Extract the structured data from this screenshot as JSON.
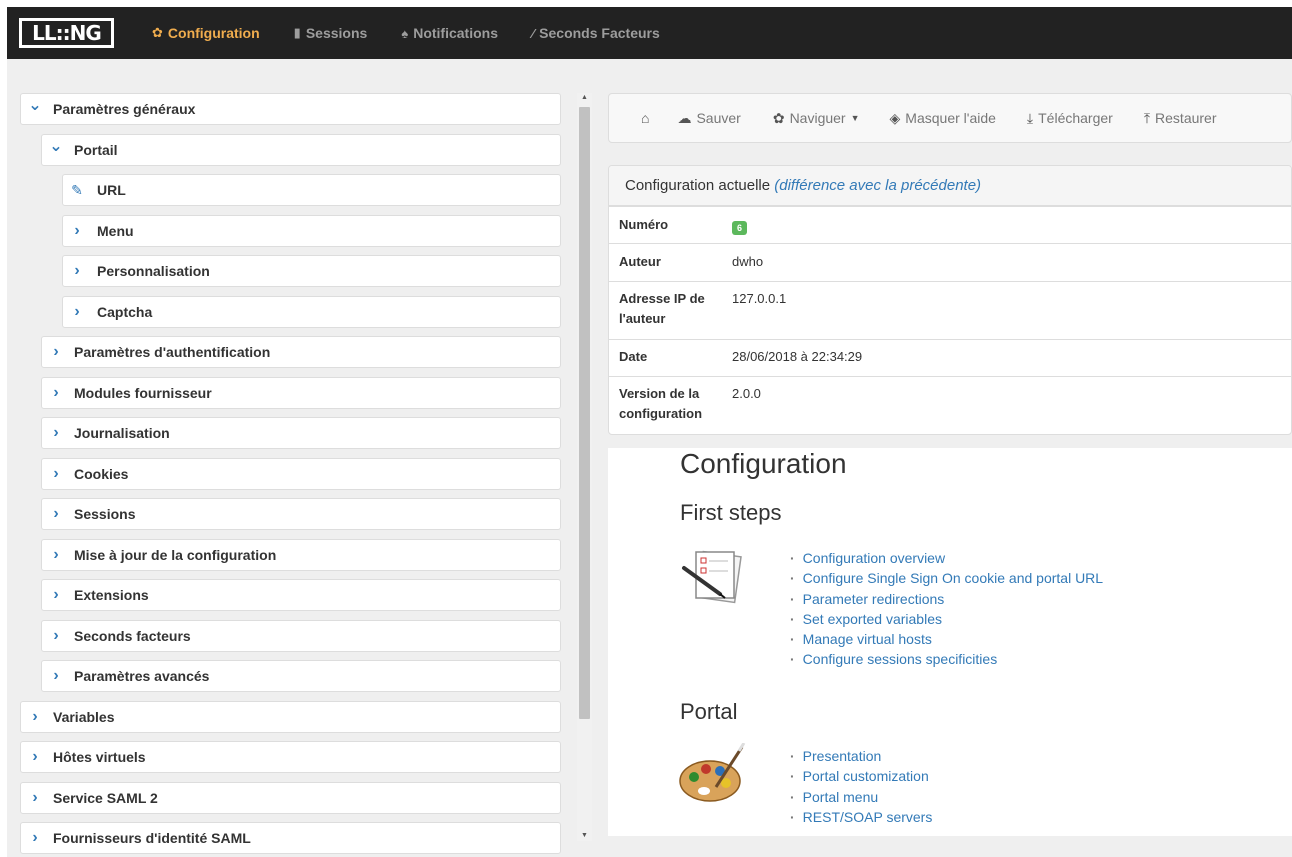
{
  "navbar": {
    "logo_text": "LL::NG",
    "items": [
      {
        "label": "Configuration",
        "icon": "gear-icon",
        "active": true
      },
      {
        "label": "Sessions",
        "icon": "copy-icon",
        "active": false
      },
      {
        "label": "Notifications",
        "icon": "bell-icon",
        "active": false
      },
      {
        "label": "Seconds Facteurs",
        "icon": "wrench-icon",
        "active": false
      }
    ]
  },
  "tree": [
    {
      "label": "Paramètres généraux",
      "level": 0,
      "state": "expanded"
    },
    {
      "label": "Portail",
      "level": 1,
      "state": "expanded"
    },
    {
      "label": "URL",
      "level": 2,
      "state": "edit"
    },
    {
      "label": "Menu",
      "level": 2,
      "state": "collapsed"
    },
    {
      "label": "Personnalisation",
      "level": 2,
      "state": "collapsed"
    },
    {
      "label": "Captcha",
      "level": 2,
      "state": "collapsed"
    },
    {
      "label": "Paramètres d'authentification",
      "level": 1,
      "state": "collapsed"
    },
    {
      "label": "Modules fournisseur",
      "level": 1,
      "state": "collapsed"
    },
    {
      "label": "Journalisation",
      "level": 1,
      "state": "collapsed"
    },
    {
      "label": "Cookies",
      "level": 1,
      "state": "collapsed"
    },
    {
      "label": "Sessions",
      "level": 1,
      "state": "collapsed"
    },
    {
      "label": "Mise à jour de la configuration",
      "level": 1,
      "state": "collapsed"
    },
    {
      "label": "Extensions",
      "level": 1,
      "state": "collapsed"
    },
    {
      "label": "Seconds facteurs",
      "level": 1,
      "state": "collapsed"
    },
    {
      "label": "Paramètres avancés",
      "level": 1,
      "state": "collapsed"
    },
    {
      "label": "Variables",
      "level": 0,
      "state": "collapsed"
    },
    {
      "label": "Hôtes virtuels",
      "level": 0,
      "state": "collapsed"
    },
    {
      "label": "Service SAML 2",
      "level": 0,
      "state": "collapsed"
    },
    {
      "label": "Fournisseurs d'identité SAML",
      "level": 0,
      "state": "collapsed"
    }
  ],
  "toolbar": {
    "home_icon": "home-icon",
    "save": "Sauver",
    "browse": "Naviguer",
    "hide_help": "Masquer l'aide",
    "download": "Télécharger",
    "restore": "Restaurer"
  },
  "config_panel": {
    "title": "Configuration actuelle",
    "diff_link": "(différence avec la précédente)",
    "rows": [
      {
        "key": "Numéro",
        "value": "6",
        "badge": true
      },
      {
        "key": "Auteur",
        "value": "dwho"
      },
      {
        "key": "Adresse IP de l'auteur",
        "value": "127.0.0.1"
      },
      {
        "key": "Date",
        "value": "28/06/2018 à 22:34:29"
      },
      {
        "key": "Version de la configuration",
        "value": "2.0.0"
      }
    ]
  },
  "help": {
    "title": "Configuration",
    "first_steps": {
      "heading": "First steps",
      "links": [
        "Configuration overview",
        "Configure Single Sign On cookie and portal URL",
        "Parameter redirections",
        "Set exported variables",
        "Manage virtual hosts",
        "Configure sessions specificities"
      ]
    },
    "portal": {
      "heading": "Portal",
      "links": [
        "Presentation",
        "Portal customization",
        "Portal menu",
        "REST/SOAP servers"
      ]
    }
  },
  "colors": {
    "accent": "#f0ad4e",
    "link": "#337ab7",
    "navbar_bg": "#222222",
    "badge": "#5cb85c"
  }
}
